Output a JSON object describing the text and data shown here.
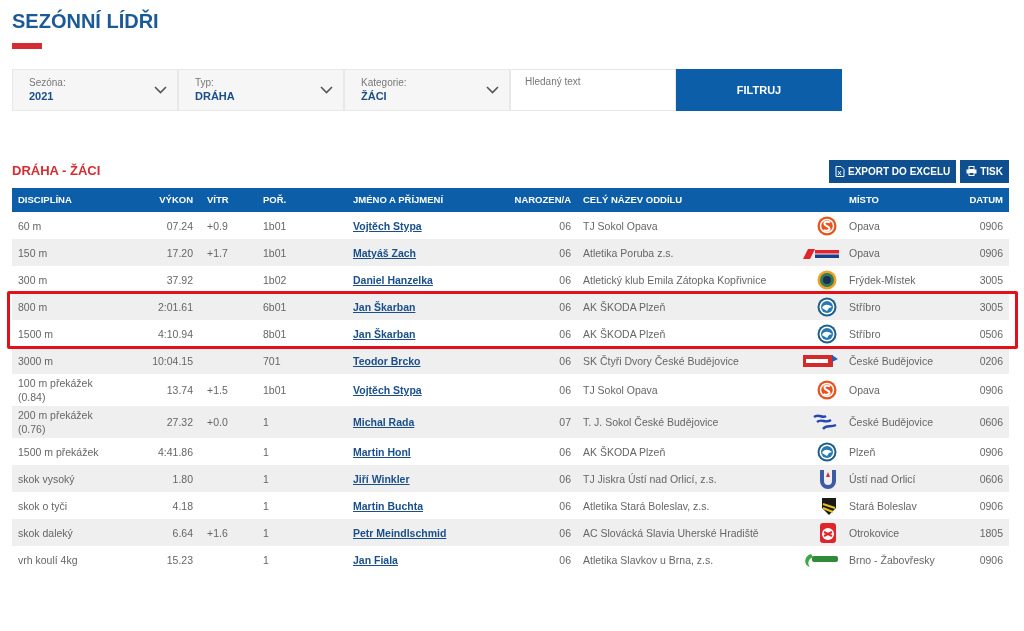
{
  "page_title": "SEZÓNNÍ LÍDŘI",
  "filters": [
    {
      "kind": "select",
      "label": "Sezóna:",
      "value": "2021"
    },
    {
      "kind": "select",
      "label": "Typ:",
      "value": "DRÁHA"
    },
    {
      "kind": "select",
      "label": "Kategorie:",
      "value": "ŽÁCI"
    },
    {
      "kind": "text",
      "placeholder": "Hledaný text"
    }
  ],
  "filter_button": "FILTRUJ",
  "section_title": "DRÁHA - ŽÁCI",
  "actions": [
    {
      "kind": "excel",
      "label": "EXPORT DO EXCELU"
    },
    {
      "kind": "print",
      "label": "TISK"
    }
  ],
  "table": {
    "columns": [
      "DISCIPLÍNA",
      "VÝKON",
      "VÍTR",
      "POŘ.",
      "JMÉNO A PŘÍJMENÍ",
      "NAROZEN/A",
      "CELÝ NÁZEV ODDÍLU",
      "MÍSTO",
      "DATUM"
    ],
    "rows": [
      {
        "discipline": "60 m",
        "performance": "07.24",
        "wind": "+0.9",
        "order": "1b01",
        "name": "Vojtěch Stypa",
        "born": "06",
        "club": "TJ Sokol Opava",
        "kind": "sokol",
        "place": "Opava",
        "date": "0906",
        "highlighted": false
      },
      {
        "discipline": "150 m",
        "performance": "17.20",
        "wind": "+1.7",
        "order": "1b01",
        "name": "Matyáš Zach",
        "born": "06",
        "club": "Atletika Poruba z.s.",
        "kind": "poruba",
        "place": "Opava",
        "date": "0906",
        "highlighted": false
      },
      {
        "discipline": "300 m",
        "performance": "37.92",
        "order": "1b02",
        "name": "Daniel Hanzelka",
        "born": "06",
        "club": "Atletický klub Emila Zátopka Kopřivnice",
        "kind": "zatopek",
        "place": "Frýdek-Místek",
        "date": "3005",
        "highlighted": false
      },
      {
        "discipline": "800 m",
        "performance": "2:01.61",
        "order": "6b01",
        "name": "Jan Škarban",
        "born": "06",
        "club": "AK ŠKODA Plzeň",
        "kind": "skoda",
        "place": "Stříbro",
        "date": "3005",
        "highlighted": true
      },
      {
        "discipline": "1500 m",
        "performance": "4:10.94",
        "order": "8b01",
        "name": "Jan Škarban",
        "born": "06",
        "club": "AK ŠKODA Plzeň",
        "kind": "skoda",
        "place": "Stříbro",
        "date": "0506",
        "highlighted": true
      },
      {
        "discipline": "3000 m",
        "performance": "10:04.15",
        "order": "701",
        "name": "Teodor Brcko",
        "born": "06",
        "club": "SK Čtyři Dvory České Budějovice",
        "kind": "banner",
        "place": "České Budějovice",
        "date": "0206",
        "highlighted": false
      },
      {
        "discipline": "100 m překážek (0.84)",
        "performance": "13.74",
        "wind": "+1.5",
        "order": "1b01",
        "name": "Vojtěch Stypa",
        "born": "06",
        "club": "TJ Sokol Opava",
        "kind": "sokol",
        "place": "Opava",
        "date": "0906",
        "highlighted": false
      },
      {
        "discipline": "200 m překážek (0.76)",
        "performance": "27.32",
        "wind": "+0.0",
        "order": "1",
        "name": "Michal Rada",
        "born": "07",
        "club": "T. J. Sokol České Budějovice",
        "kind": "wave",
        "place": "České Budějovice",
        "date": "0606",
        "highlighted": false
      },
      {
        "discipline": "1500 m překážek",
        "performance": "4:41.86",
        "order": "1",
        "name": "Martin Honl",
        "born": "06",
        "club": "AK ŠKODA Plzeň",
        "kind": "skoda",
        "place": "Plzeň",
        "date": "0906",
        "highlighted": false
      },
      {
        "discipline": "skok vysoký",
        "performance": "1.80",
        "order": "1",
        "name": "Jiří Winkler",
        "born": "06",
        "club": "TJ Jiskra Ústí nad Orlicí, z.s.",
        "kind": "jiskra",
        "place": "Ústí nad Orlicí",
        "date": "0606",
        "highlighted": false
      },
      {
        "discipline": "skok o tyči",
        "performance": "4.18",
        "order": "1",
        "name": "Martin Buchta",
        "born": "06",
        "club": "Atletika Stará Boleslav, z.s.",
        "kind": "boleslav",
        "place": "Stará Boleslav",
        "date": "0906",
        "highlighted": false
      },
      {
        "discipline": "skok daleký",
        "performance": "6.64",
        "wind": "+1.6",
        "order": "1",
        "name": "Petr Meindlschmid",
        "born": "06",
        "club": "AC Slovácká Slavia Uherské Hradiště",
        "kind": "slavia",
        "place": "Otrokovice",
        "date": "1805",
        "highlighted": false
      },
      {
        "discipline": "vrh koulí 4kg",
        "performance": "15.23",
        "order": "1",
        "name": "Jan Fiala",
        "born": "06",
        "club": "Atletika Slavkov u Brna, z.s.",
        "kind": "swoosh",
        "place": "Brno - Žabovřesky",
        "date": "0906",
        "highlighted": false
      }
    ]
  }
}
